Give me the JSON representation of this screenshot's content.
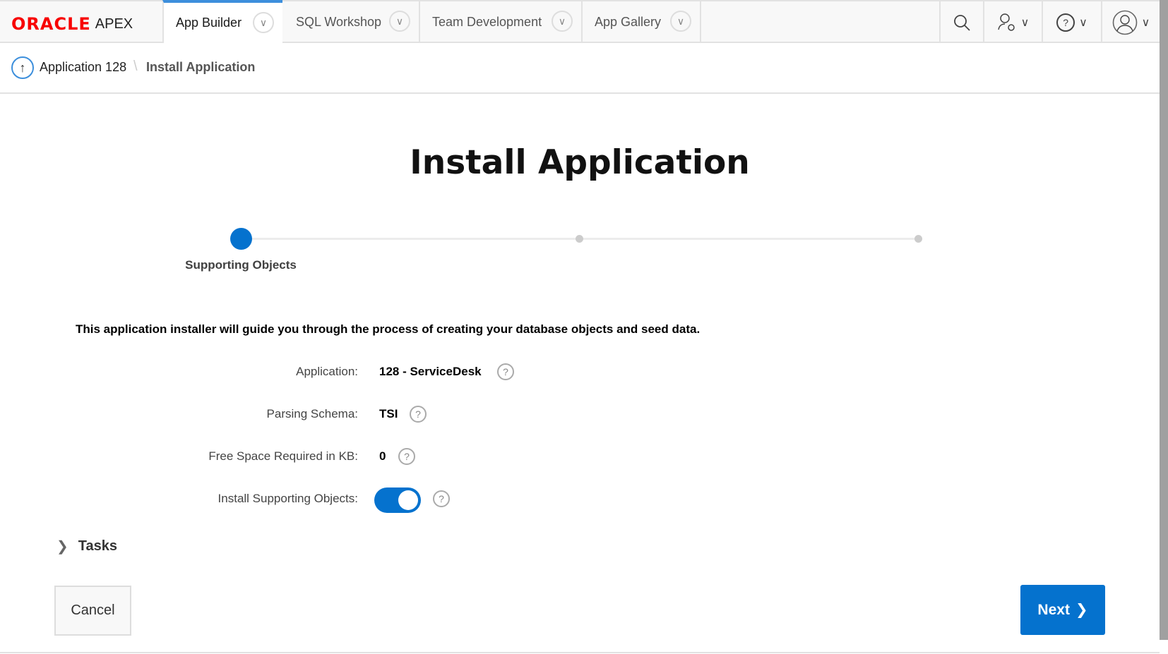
{
  "header": {
    "logo_oracle": "ORACLE",
    "logo_apex": "APEX",
    "tabs": [
      {
        "label": "App Builder"
      },
      {
        "label": "SQL Workshop"
      },
      {
        "label": "Team Development"
      },
      {
        "label": "App Gallery"
      }
    ]
  },
  "breadcrumb": {
    "parent": "Application 128",
    "current": "Install Application"
  },
  "page": {
    "title": "Install Application",
    "step_label": "Supporting Objects",
    "intro": "This application installer will guide you through the process of creating your database objects and seed data."
  },
  "form": {
    "application_label": "Application:",
    "application_value": "128 - ServiceDesk",
    "schema_label": "Parsing Schema:",
    "schema_value": "TSI",
    "space_label": "Free Space Required in KB:",
    "space_value": "0",
    "install_label": "Install Supporting Objects:",
    "install_on": true
  },
  "tasks_label": "Tasks",
  "buttons": {
    "cancel": "Cancel",
    "next": "Next"
  },
  "colors": {
    "accent": "#0572ce"
  }
}
